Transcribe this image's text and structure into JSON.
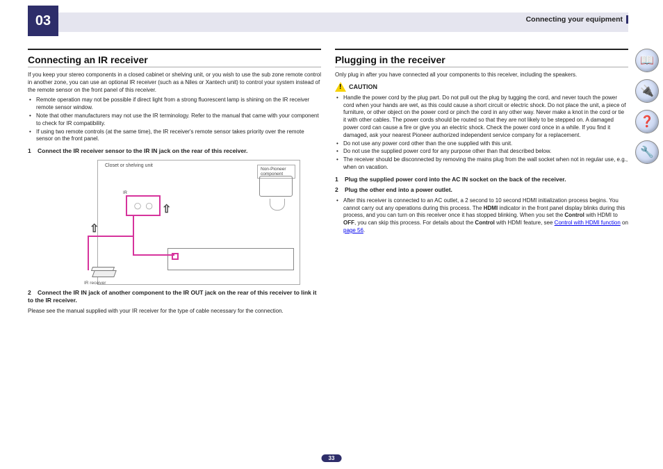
{
  "chapter_number": "03",
  "breadcrumb": "Connecting your equipment",
  "page_number": "33",
  "side_icons": [
    {
      "name": "book-icon",
      "glyph": "📖"
    },
    {
      "name": "device-icon",
      "glyph": "🔌"
    },
    {
      "name": "help-icon",
      "glyph": "❓"
    },
    {
      "name": "tools-icon",
      "glyph": "🔧"
    }
  ],
  "left": {
    "heading": "Connecting an IR receiver",
    "intro": "If you keep your stereo components in a closed cabinet or shelving unit, or you wish to use the sub zone remote control in another zone, you can use an optional IR receiver (such as a Niles or Xantech unit) to control your system instead of the remote sensor on the front panel of this receiver.",
    "bullets": [
      "Remote operation may not be possible if direct light from a strong fluorescent lamp is shining on the IR receiver remote sensor window.",
      "Note that other manufacturers may not use the IR terminology. Refer to the manual that came with your component to check for IR compatibility.",
      "If using two remote controls (at the same time), the IR receiver's remote sensor takes priority over the remote sensor on the front panel."
    ],
    "step1_num": "1",
    "step1": "Connect the IR receiver sensor to the IR IN jack on the rear of this receiver.",
    "figure": {
      "closet_label": "Closet or shelving unit",
      "nonpioneer_label": "Non-Pioneer component",
      "ir_port_label": "IR",
      "ir_receiver_label": "IR receiver"
    },
    "step2_num": "2",
    "step2": "Connect the IR IN jack of another component to the IR OUT jack on the rear of this receiver to link it to the IR receiver.",
    "note": "Please see the manual supplied with your IR receiver for the type of cable necessary for the connection."
  },
  "right": {
    "heading": "Plugging in the receiver",
    "intro": "Only plug in after you have connected all your components to this receiver, including the speakers.",
    "caution_label": "CAUTION",
    "bullets": [
      "Handle the power cord by the plug part. Do not pull out the plug by tugging the cord, and never touch the power cord when your hands are wet, as this could cause a short circuit or electric shock. Do not place the unit, a piece of furniture, or other object on the power cord or pinch the cord in any other way. Never make a knot in the cord or tie it with other cables. The power cords should be routed so that they are not likely to be stepped on. A damaged power cord can cause a fire or give you an electric shock. Check the power cord once in a while. If you find it damaged, ask your nearest Pioneer authorized independent service company for a replacement.",
      "Do not use any power cord other than the one supplied with this unit.",
      "Do not use the supplied power cord for any purpose other than that described below.",
      "The receiver should be disconnected by removing the mains plug from the wall socket when not in regular use, e.g., when on vacation."
    ],
    "step1_num": "1",
    "step1": "Plug the supplied power cord into the AC IN socket on the back of the receiver.",
    "step2_num": "2",
    "step2": "Plug the other end into a power outlet.",
    "note_pre": "After this receiver is connected to an AC outlet, a 2 second to 10 second HDMI initialization process begins. You cannot carry out any operations during this process. The ",
    "note_bold1": "HDMI",
    "note_mid1": " indicator in the front panel display blinks during this process, and you can turn on this receiver once it has stopped blinking. When you set the ",
    "note_bold2": "Control",
    "note_mid2": " with HDMI to ",
    "note_bold3": "OFF",
    "note_mid3": ", you can skip this process. For details about the ",
    "note_bold4": "Control",
    "note_mid4": " with HDMI feature, see ",
    "link1": "Control with HDMI function",
    "note_on": " on ",
    "link2": "page 56",
    "note_end": "."
  }
}
